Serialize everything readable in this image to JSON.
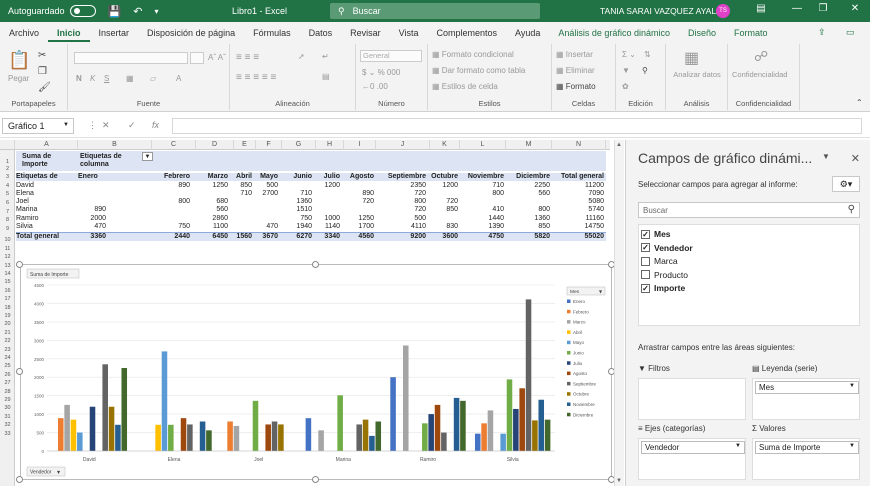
{
  "titlebar": {
    "autosave": "Autoguardado",
    "doc_title": "Libro1 - Excel",
    "search_placeholder": "Buscar",
    "user": "TANIA SARAI VAZQUEZ AYALA",
    "initials": "TS"
  },
  "ribbon": {
    "tabs": [
      "Archivo",
      "Inicio",
      "Insertar",
      "Disposición de página",
      "Fórmulas",
      "Datos",
      "Revisar",
      "Vista",
      "Complementos",
      "Ayuda"
    ],
    "context_tabs": [
      "Análisis de gráfico dinámico",
      "Diseño",
      "Formato"
    ],
    "active_tab": "Inicio",
    "groups": {
      "clipboard": "Portapapeles",
      "paste": "Pegar",
      "font": "Fuente",
      "alignment": "Alineación",
      "number": "Número",
      "number_format": "General",
      "styles": "Estilos",
      "cond_format": "Formato condicional",
      "table_format": "Dar formato como tabla",
      "cell_styles": "Estilos de celda",
      "cells": "Celdas",
      "insert": "Insertar",
      "delete": "Eliminar",
      "format": "Formato",
      "editing": "Edición",
      "analysis": "Análisis",
      "analyze_data": "Analizar datos",
      "confidentiality": "Confidencialidad"
    }
  },
  "formula_bar": {
    "name_box": "Gráfico 1",
    "fx": "fx"
  },
  "grid": {
    "columns": [
      "A",
      "B",
      "C",
      "D",
      "E",
      "F",
      "G",
      "H",
      "I",
      "J",
      "K",
      "L",
      "M",
      "N"
    ],
    "pivot": {
      "value_label_1": "Suma de",
      "value_label_2": "Importe",
      "col_label_1": "Etiquetas de",
      "col_label_2": "columna",
      "row_label": "Etiquetas de",
      "months": [
        "Enero",
        "Febrero",
        "Marzo",
        "Abril",
        "Mayo",
        "Junio",
        "Julio",
        "Agosto",
        "Septiembre",
        "Octubre",
        "Noviembre",
        "Diciembre"
      ],
      "total_col": "Total general",
      "rows": [
        {
          "name": "David",
          "values": [
            "",
            "890",
            "1250",
            "850",
            "500",
            "",
            "1200",
            "",
            "2350",
            "1200",
            "710",
            "2250"
          ],
          "total": "11200"
        },
        {
          "name": "Elena",
          "values": [
            "",
            "",
            "",
            "710",
            "2700",
            "710",
            "",
            "890",
            "720",
            "",
            "800",
            "560"
          ],
          "total": "7090"
        },
        {
          "name": "Joel",
          "values": [
            "",
            "800",
            "680",
            "",
            "",
            "1360",
            "",
            "720",
            "800",
            "720",
            "",
            ""
          ],
          "total": "5080"
        },
        {
          "name": "Marina",
          "values": [
            "890",
            "",
            "560",
            "",
            "",
            "1510",
            "",
            "",
            "720",
            "850",
            "410",
            "800"
          ],
          "total": "5740"
        },
        {
          "name": "Ramiro",
          "values": [
            "2000",
            "",
            "2860",
            "",
            "",
            "750",
            "1000",
            "1250",
            "500",
            "",
            "1440",
            "1360"
          ],
          "total": "11160"
        },
        {
          "name": "Silvia",
          "values": [
            "470",
            "750",
            "1100",
            "",
            "470",
            "1940",
            "1140",
            "1700",
            "4110",
            "830",
            "1390",
            "850"
          ],
          "total": "14750"
        }
      ],
      "grand_total_label": "Total general",
      "grand_totals": [
        "3360",
        "2440",
        "6450",
        "1560",
        "3670",
        "6270",
        "3340",
        "4560",
        "9200",
        "3600",
        "4750",
        "5820"
      ],
      "grand_total": "55020"
    }
  },
  "chart_data": {
    "type": "bar",
    "title": "",
    "value_field_button": "Suma de Importe",
    "axis_field_button": "Vendedor",
    "legend_field_button": "Mes",
    "legend_position": "right",
    "ylim": [
      0,
      4500
    ],
    "yticks": [
      "0",
      "500",
      "1000",
      "1500",
      "2000",
      "2500",
      "3000",
      "3500",
      "4000",
      "4500"
    ],
    "categories": [
      "David",
      "Elena",
      "Joel",
      "Marina",
      "Ramiro",
      "Silvia"
    ],
    "series": [
      {
        "name": "Enero",
        "color": "#4472c4",
        "values": [
          0,
          0,
          0,
          890,
          2000,
          470
        ]
      },
      {
        "name": "Febrero",
        "color": "#ed7d31",
        "values": [
          890,
          0,
          800,
          0,
          0,
          750
        ]
      },
      {
        "name": "Marzo",
        "color": "#a5a5a5",
        "values": [
          1250,
          0,
          680,
          560,
          2860,
          1100
        ]
      },
      {
        "name": "Abril",
        "color": "#ffc000",
        "values": [
          850,
          710,
          0,
          0,
          0,
          0
        ]
      },
      {
        "name": "Mayo",
        "color": "#5b9bd5",
        "values": [
          500,
          2700,
          0,
          0,
          0,
          470
        ]
      },
      {
        "name": "Junio",
        "color": "#70ad47",
        "values": [
          0,
          710,
          1360,
          1510,
          750,
          1940
        ]
      },
      {
        "name": "Julio",
        "color": "#264478",
        "values": [
          1200,
          0,
          0,
          0,
          1000,
          1140
        ]
      },
      {
        "name": "Agosto",
        "color": "#9e480e",
        "values": [
          0,
          890,
          720,
          0,
          1250,
          1700
        ]
      },
      {
        "name": "Septiembre",
        "color": "#636363",
        "values": [
          2350,
          720,
          800,
          720,
          500,
          4110
        ]
      },
      {
        "name": "Octubre",
        "color": "#997300",
        "values": [
          1200,
          0,
          720,
          850,
          0,
          830
        ]
      },
      {
        "name": "Noviembre",
        "color": "#255e91",
        "values": [
          710,
          800,
          0,
          410,
          1440,
          1390
        ]
      },
      {
        "name": "Diciembre",
        "color": "#43682b",
        "values": [
          2250,
          560,
          0,
          800,
          1360,
          850
        ]
      }
    ]
  },
  "pane": {
    "title": "Campos de gráfico dinámi...",
    "subtitle": "Seleccionar campos para agregar al informe:",
    "search_placeholder": "Buscar",
    "fields": [
      {
        "label": "Mes",
        "checked": true
      },
      {
        "label": "Vendedor",
        "checked": true
      },
      {
        "label": "Marca",
        "checked": false
      },
      {
        "label": "Producto",
        "checked": false
      },
      {
        "label": "Importe",
        "checked": true
      }
    ],
    "areas_label": "Arrastrar campos entre las áreas siguientes:",
    "filters": "Filtros",
    "legend": "Leyenda (serie)",
    "legend_item": "Mes",
    "axis": "Ejes (categorías)",
    "axis_item": "Vendedor",
    "values": "Valores",
    "values_item": "Suma de Importe"
  }
}
